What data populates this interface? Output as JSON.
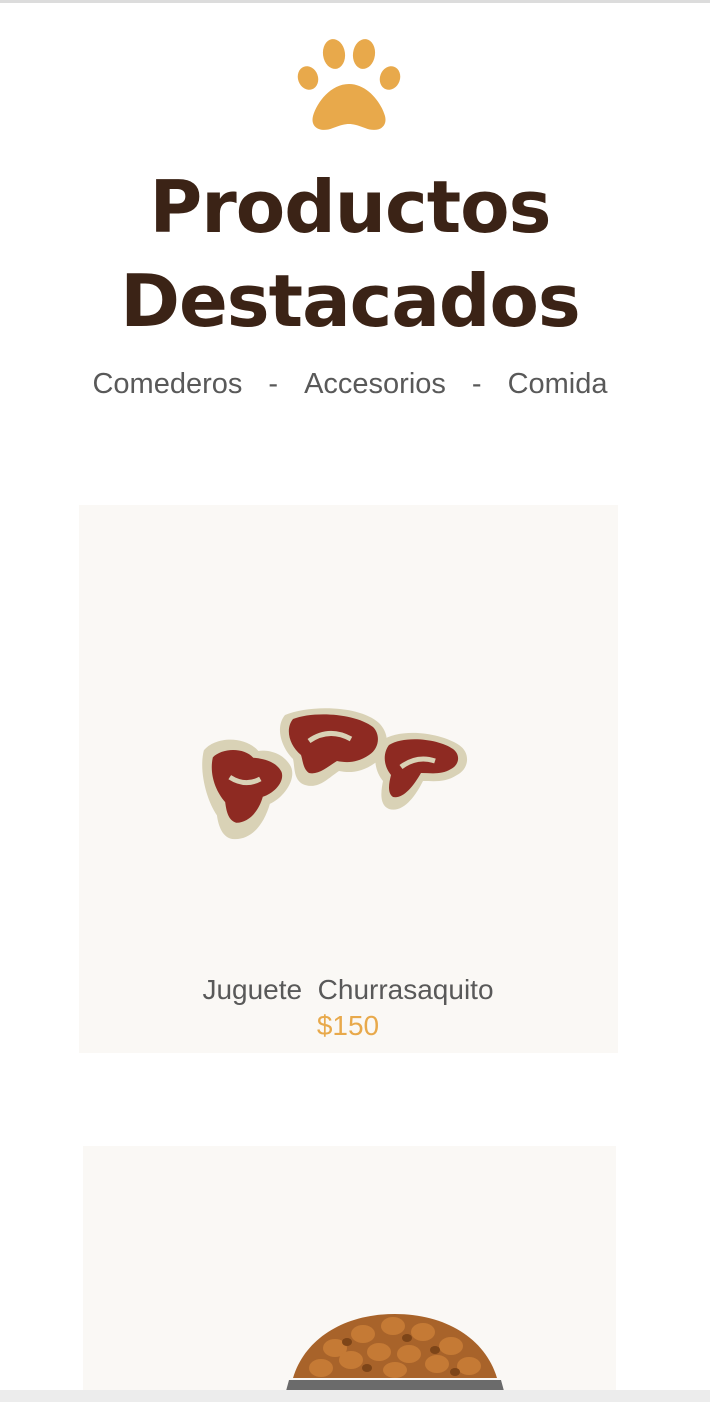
{
  "header": {
    "logo_icon": "paw-icon",
    "title": "Productos Destacados",
    "accent_color": "#e8a94b",
    "title_color": "#3b2316"
  },
  "nav": {
    "items": [
      "Comederos",
      "Accesorios",
      "Comida"
    ],
    "separator": "-"
  },
  "products": [
    {
      "name": "Juguete  Churrasaquito",
      "price": "$150",
      "image_icon": "steak-treats-image"
    },
    {
      "name": "",
      "price": "",
      "image_icon": "dog-food-bowl-image"
    }
  ]
}
